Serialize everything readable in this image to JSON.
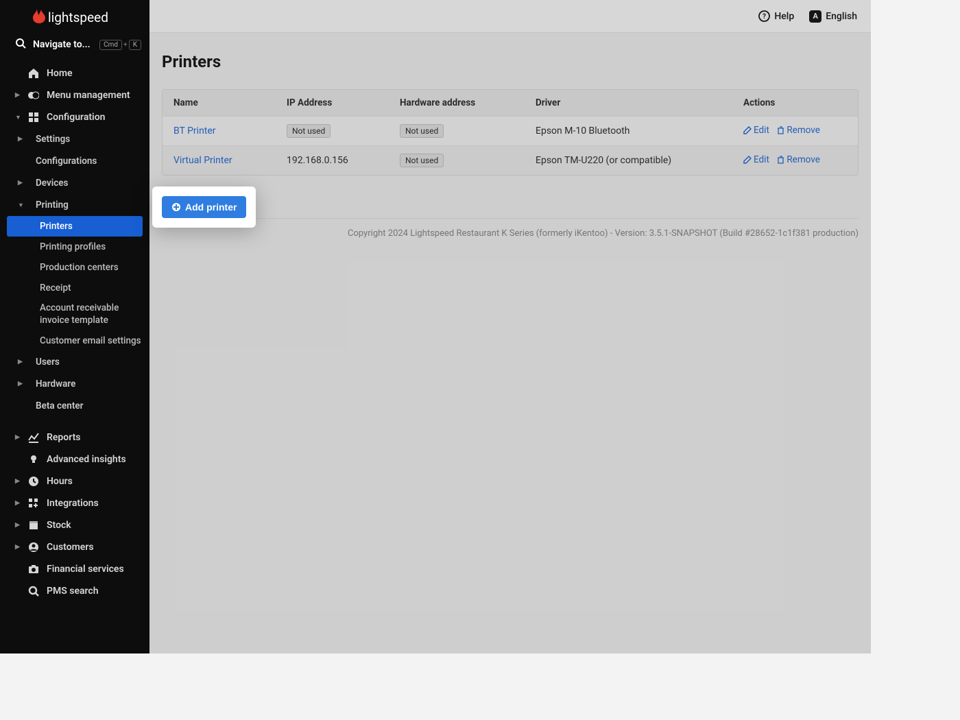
{
  "brand": "lightspeed",
  "search": {
    "label": "Navigate to...",
    "k1": "Cmd",
    "k2": "K"
  },
  "sidebar": {
    "home": "Home",
    "menu_mgmt": "Menu management",
    "configuration": "Configuration",
    "config_children": {
      "settings": "Settings",
      "configurations": "Configurations",
      "devices": "Devices",
      "printing": "Printing",
      "printing_children": {
        "printers": "Printers",
        "profiles": "Printing profiles",
        "production": "Production centers",
        "receipt": "Receipt",
        "ar_invoice": "Account receivable invoice template",
        "cust_email": "Customer email settings"
      },
      "users": "Users",
      "hardware": "Hardware",
      "beta": "Beta center"
    },
    "reports": "Reports",
    "insights": "Advanced insights",
    "hours": "Hours",
    "integrations": "Integrations",
    "stock": "Stock",
    "customers": "Customers",
    "financial": "Financial services",
    "pms": "PMS search"
  },
  "topbar": {
    "help": "Help",
    "language": "English",
    "lang_badge": "A"
  },
  "page": {
    "title": "Printers"
  },
  "table": {
    "headers": {
      "name": "Name",
      "ip": "IP Address",
      "hw": "Hardware address",
      "driver": "Driver",
      "actions": "Actions"
    },
    "not_used": "Not used",
    "edit": "Edit",
    "remove": "Remove",
    "rows": [
      {
        "name": "BT Printer",
        "ip_badge": true,
        "ip": "",
        "hw_badge": true,
        "hw": "",
        "driver": "Epson M-10 Bluetooth"
      },
      {
        "name": "Virtual Printer",
        "ip_badge": false,
        "ip": "192.168.0.156",
        "hw_badge": true,
        "hw": "",
        "driver": "Epson TM-U220 (or compatible)"
      }
    ]
  },
  "add_printer": "Add printer",
  "footer": "Copyright 2024 Lightspeed Restaurant K Series (formerly iKentoo) - Version: 3.5.1-SNAPSHOT (Build #28652-1c1f381 production)"
}
